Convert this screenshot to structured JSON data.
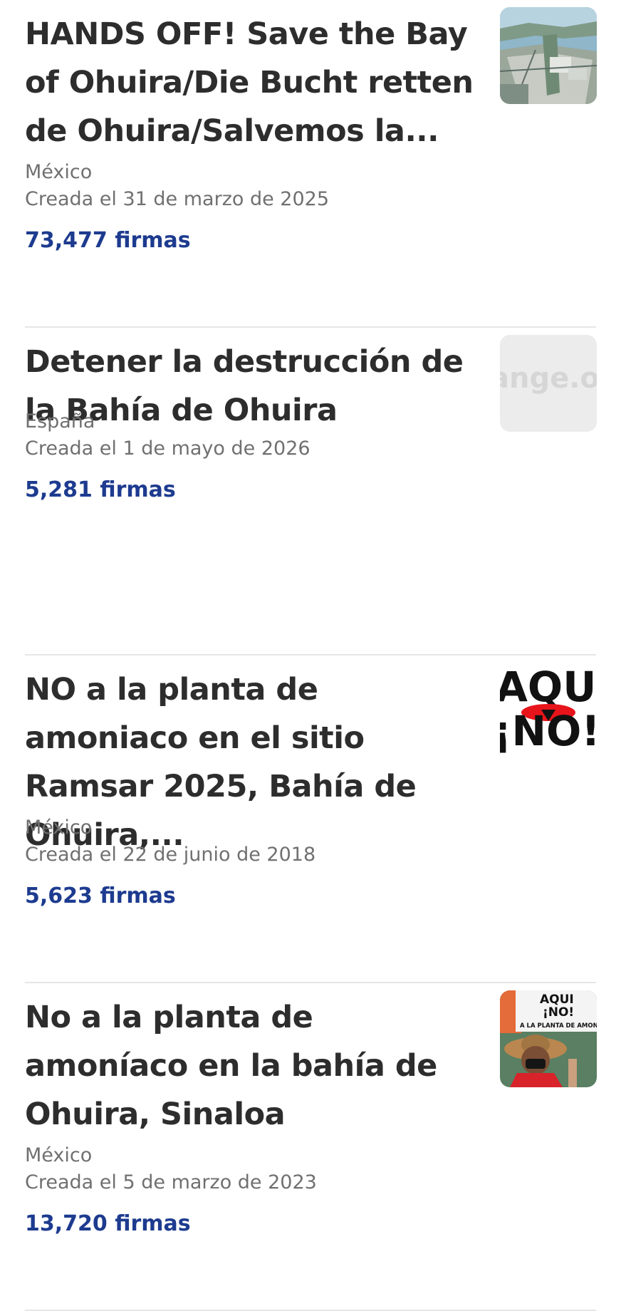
{
  "petitions": [
    {
      "title": "HANDS OFF! Save the Bay of Ohuira/Die Bucht retten de Ohuira/Salvemos la...",
      "country": "México",
      "created": "Creada el 31 de marzo de 2025",
      "signatures": "73,477 firmas",
      "thumbnail": "aerial-bay-photo"
    },
    {
      "title": "Detener la destrucción de la Bahía de Ohuira",
      "country": "España",
      "created": "Creada el 1 de mayo de 2026",
      "signatures": "5,281 firmas",
      "thumbnail": "change-org-placeholder",
      "thumbnail_text": "ange.o"
    },
    {
      "title": "NO a la planta de amoniaco en el sitio Ramsar 2025, Bahía de Ohuira,...",
      "country": "México",
      "created": "Creada el 22 de junio de 2018",
      "signatures": "5,623 firmas",
      "thumbnail": "aqui-no-logo",
      "thumbnail_text": [
        "AQUI",
        "¡NO!"
      ]
    },
    {
      "title": "No a la planta de amoníaco en la bahía de Ohuira, Sinaloa",
      "country": "México",
      "created": "Creada el 5 de marzo de 2023",
      "signatures": "13,720 firmas",
      "thumbnail": "protester-sign-photo",
      "thumbnail_text": [
        "AQUI",
        "¡NO!",
        "A LA PLANTA DE AMONIACO"
      ]
    }
  ],
  "colors": {
    "signatures": "#1d3b8f",
    "title": "#2d2d2d",
    "meta": "#707070",
    "divider": "#e6e6e6",
    "logo_red": "#e8141b"
  }
}
